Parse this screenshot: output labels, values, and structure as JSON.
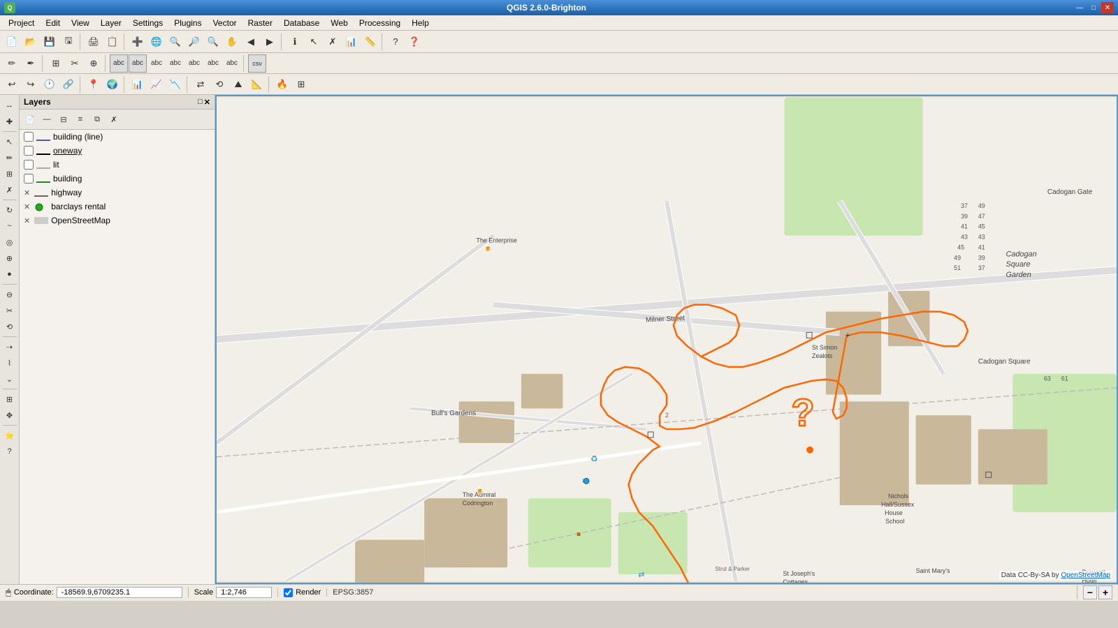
{
  "app": {
    "title": "QGIS 2.6.0-Brighton",
    "icon": "Q"
  },
  "titlebar": {
    "minimize": "—",
    "maximize": "□",
    "close": "✕"
  },
  "menu": {
    "items": [
      "Project",
      "Edit",
      "View",
      "Layer",
      "Settings",
      "Plugins",
      "Vector",
      "Raster",
      "Database",
      "Web",
      "Processing",
      "Help"
    ]
  },
  "layers": {
    "title": "Layers",
    "items": [
      {
        "name": "building (line)",
        "type": "line",
        "color": "#5555aa",
        "checked": false,
        "style": "line"
      },
      {
        "name": "oneway",
        "type": "line",
        "color": "#000000",
        "checked": false,
        "style": "underline"
      },
      {
        "name": "lit",
        "type": "line",
        "color": "#000000",
        "checked": false,
        "style": "normal"
      },
      {
        "name": "building",
        "type": "line",
        "color": "#228822",
        "checked": false,
        "style": "normal"
      },
      {
        "name": "highway",
        "type": "x",
        "color": "#000000",
        "checked": false,
        "style": "x"
      },
      {
        "name": "barclays rental",
        "type": "point",
        "color": "#22aa22",
        "checked": false,
        "style": "x"
      },
      {
        "name": "OpenStreetMap",
        "type": "raster",
        "color": "#000000",
        "checked": false,
        "style": "x"
      }
    ]
  },
  "statusbar": {
    "coordinate_label": "Coordinate:",
    "coordinate_value": "-18569.9,6709235.1",
    "scale_label": "Scale",
    "scale_value": "1:2,746",
    "render_label": "Render",
    "epsg_label": "EPSG:3857",
    "attribution": "Data CC-By-SA by OpenStreetMap"
  }
}
